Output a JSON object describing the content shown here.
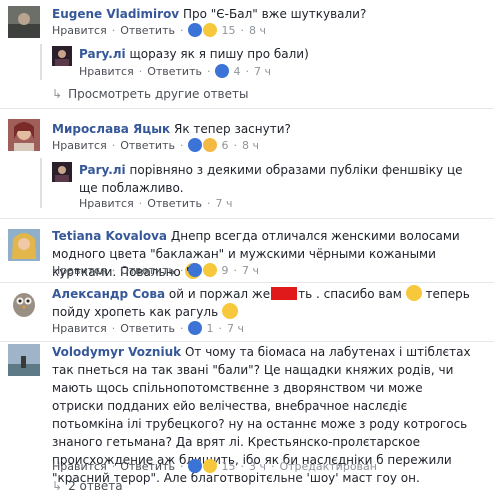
{
  "ui": {
    "like": "Нравится",
    "reply": "Ответить",
    "more_replies": "Просмотреть другие ответы",
    "edited": "Отредактирован",
    "bottom_replies": "2 ответа"
  },
  "comments": [
    {
      "name": "Eugene Vladimirov",
      "text": "Про \"Є-Бал\" вже шуткували?",
      "reactions": "15",
      "time": "8 ч"
    },
    {
      "name": "Pary.лі",
      "text": "щоразу як я пишу про бали)",
      "reactions": "4",
      "time": "7 ч"
    },
    {
      "name": "Мирослава Яцык",
      "text": "Як тепер заснути?",
      "reactions": "6",
      "time": "8 ч"
    },
    {
      "name": "Pary.лі",
      "text": "порівняно з деякими образами публіки феншвіку це ще поблажливо.",
      "time": "7 ч"
    },
    {
      "name": "Tetiana Kovalova",
      "text": "Днепр всегда отличался женскими волосами модного цвета \"баклажан\" и мужскими чёрными кожаными куртками. Повально",
      "reactions": "9",
      "time": "7 ч"
    },
    {
      "name": "Александр Сова",
      "text_a": "ой и поржал же",
      "text_b": "ть . спасибо вам",
      "text_c": "теперь пойду хропеть как рагуль",
      "reactions": "1",
      "time": "7 ч"
    },
    {
      "name": "Volodymyr Vozniuk",
      "text": "От чому та біомаса на лабутенах і штіблєтах так пнеться на так звані \"бали\"? Це нащадки княжих родів, чи мають щось спільнопотомствєнне з дворянством чи може отриски подданих ейо велічества, вне­брачное наслєдіє потьомкіна ілі трубецкого? ну на останнє може з роду котрогось знаного гетьмана? Да врят лі. Крестьянско-пролєтарское происхождение аж блищить, ібо як би наслєдніки б пережили \"красний терор\". Але благотворітєльне 'шоу' маст гоу он.",
      "reactions": "15",
      "time": "3 ч"
    }
  ]
}
